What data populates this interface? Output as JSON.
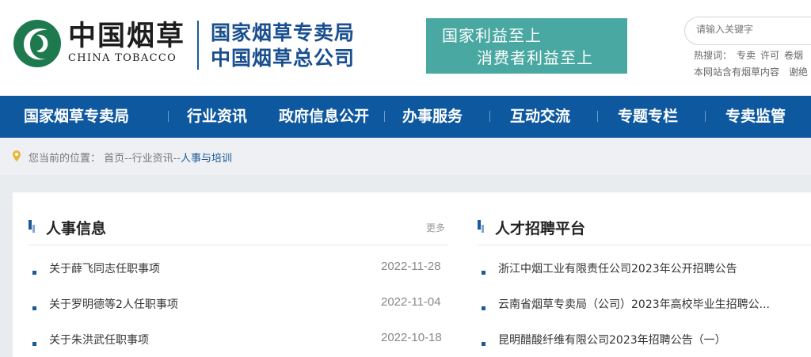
{
  "colors": {
    "primary_blue": "#0e58a0",
    "logo_green": "#1e7a4e",
    "slogan_teal": "#4aa8a2",
    "bullet_blue": "#1a5a99"
  },
  "header": {
    "logo_cn": "中国烟草",
    "logo_en": "CHINA TOBACCO",
    "org_line1": "国家烟草专卖局",
    "org_line2": "中国烟草总公司",
    "slogan_line1": "国家利益至上",
    "slogan_line2": "消费者利益至上",
    "search_placeholder": "请输入关键字",
    "hot_label": "热搜词：",
    "hot_words": [
      "专卖",
      "许可",
      "卷烟"
    ],
    "site_search_text": "本网站含有烟草内容　谢绝"
  },
  "nav": {
    "items": [
      "国家烟草专卖局",
      "行业资讯",
      "政府信息公开",
      "办事服务",
      "互动交流",
      "专题专栏",
      "专卖监管"
    ]
  },
  "breadcrumb": {
    "prefix": "您当前的位置：",
    "home": "首页",
    "sep1": "--",
    "level1": "行业资讯",
    "sep2": "--",
    "current": "人事与培训"
  },
  "personnel": {
    "title": "人事信息",
    "more": "更多",
    "items": [
      {
        "title": "关于薛飞同志任职事项",
        "date": "2022-11-28"
      },
      {
        "title": "关于罗明德等2人任职事项",
        "date": "2022-11-04"
      },
      {
        "title": "关于朱洪武任职事项",
        "date": "2022-10-18"
      }
    ]
  },
  "recruit": {
    "title": "人才招聘平台",
    "items": [
      {
        "title": "浙江中烟工业有限责任公司2023年公开招聘公告"
      },
      {
        "title": "云南省烟草专卖局（公司）2023年高校毕业生招聘公..."
      },
      {
        "title": "昆明醋酸纤维有限公司2023年招聘公告（一）"
      }
    ]
  }
}
